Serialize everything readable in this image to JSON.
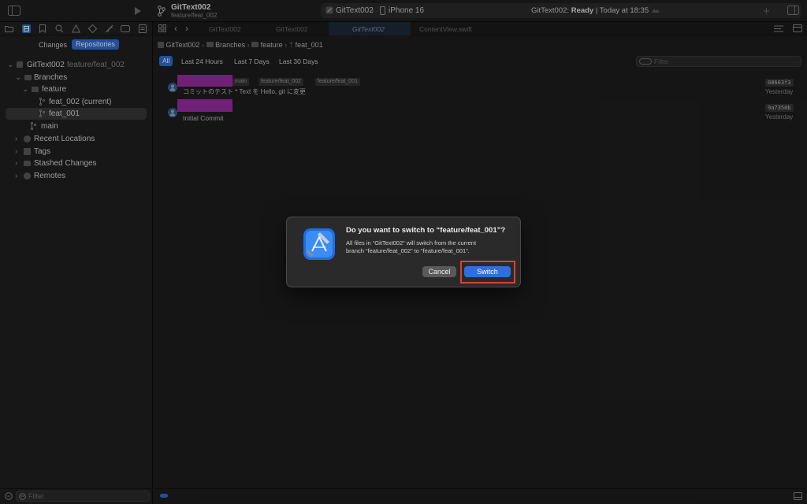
{
  "titlebar": {
    "project_name": "GitText002",
    "branch": "feature/feat_002",
    "scheme": "GitText002",
    "destination": "iPhone 16",
    "status_project": "GitText002:",
    "status_state": "Ready",
    "status_time": "| Today at 18:35"
  },
  "tabs": [
    {
      "label": "GitText002"
    },
    {
      "label": "GitText002"
    },
    {
      "label": "GitText002"
    },
    {
      "label": "ContentView.swift"
    }
  ],
  "sidebar": {
    "segments": {
      "changes": "Changes",
      "repositories": "Repositories"
    },
    "repo": {
      "name": "GitText002",
      "branch": "feature/feat_002"
    },
    "items": {
      "branches": "Branches",
      "feature": "feature",
      "feat_002": "feat_002 (current)",
      "feat_001": "feat_001",
      "main": "main",
      "recent_locations": "Recent Locations",
      "tags": "Tags",
      "stashed_changes": "Stashed Changes",
      "remotes": "Remotes"
    },
    "filter_placeholder": "Filter"
  },
  "breadcrumb": [
    "GitText002",
    "Branches",
    "feature",
    "feat_001"
  ],
  "time_filters": [
    "All",
    "Last 24 Hours",
    "Last 7 Days",
    "Last 30 Days"
  ],
  "history_filter_placeholder": "Filter",
  "commits": [
    {
      "tags": [
        "main",
        "feature/feat_002",
        "feature/feat_001"
      ],
      "message": "コミットのテスト * Text を Hello, git に変更",
      "hash": "08603f3",
      "date": "Yesterday"
    },
    {
      "tags": [],
      "message": "Initial Commit",
      "hash": "9a7350b",
      "date": "Yesterday"
    }
  ],
  "dialog": {
    "title": "Do you want to switch to “feature/feat_001”?",
    "body_line1": "All files in “GitText002” will switch from the current",
    "body_line2": "branch “feature/feat_002” to “feature/feat_001”.",
    "cancel": "Cancel",
    "switch": "Switch"
  },
  "colors": {
    "accent": "#2f6fdc",
    "redacted_avatar": "#9b2da5",
    "highlight_border": "#e0402a"
  }
}
